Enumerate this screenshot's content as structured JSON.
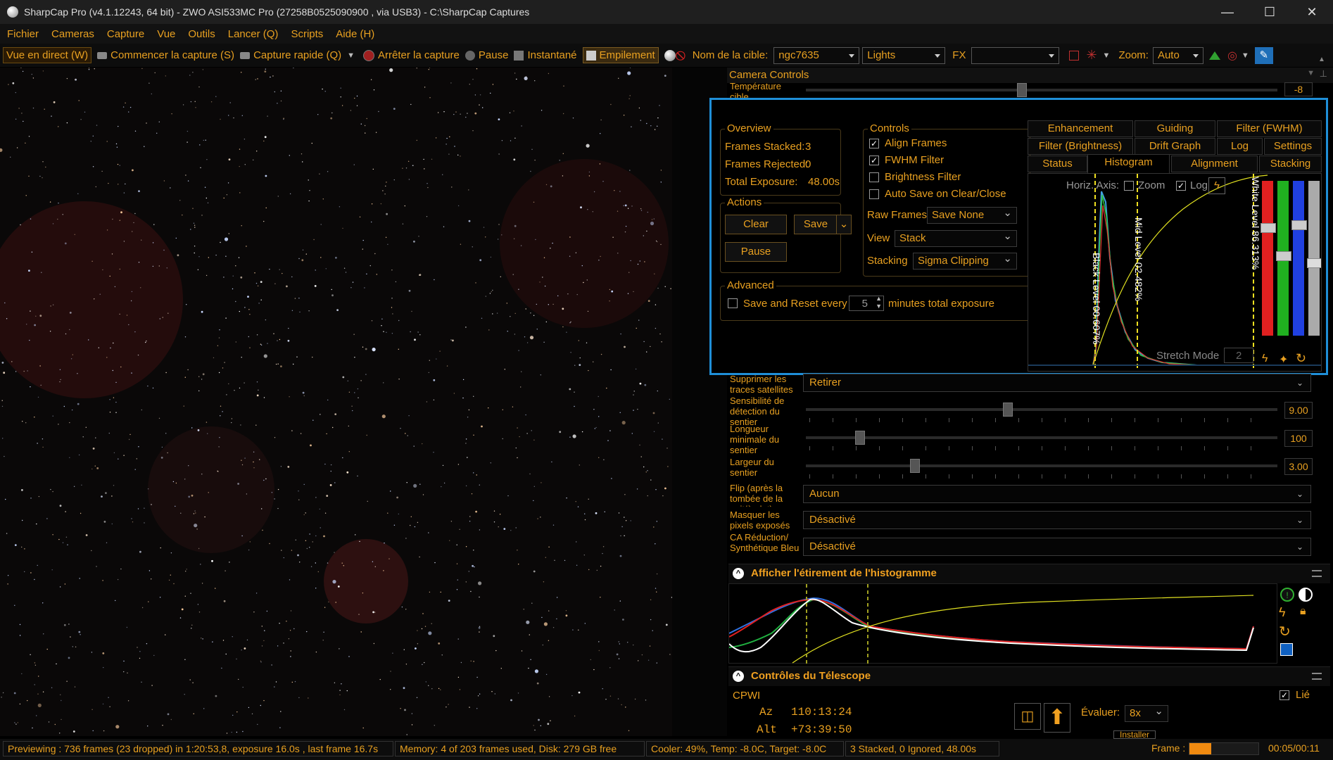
{
  "window": {
    "title": "SharpCap Pro (v4.1.12243, 64 bit) - ZWO ASI533MC Pro (27258B0525090900 , via USB3) - C:\\SharpCap Captures",
    "minimize": "—",
    "maximize": "☐",
    "close": "✕"
  },
  "menu": [
    "Fichier",
    "Cameras",
    "Capture",
    "Vue",
    "Outils",
    "Lancer (Q)",
    "Scripts",
    "Aide (H)"
  ],
  "toolbar": {
    "live_view": "Vue en direct (W)",
    "start_capture": "Commencer la capture (S)",
    "quick_capture": "Capture rapide (Q)",
    "stop_capture": "Arrêter la capture",
    "pause": "Pause",
    "snapshot": "Instantané",
    "stacking": "Empilement",
    "target_label": "Nom de la cible:",
    "target_value": "ngc7635",
    "frame_type": "Lights",
    "fx_label": "FX",
    "fx_value": "",
    "zoom_label": "Zoom:",
    "zoom_value": "Auto"
  },
  "camera_controls": {
    "title": "Camera Controls",
    "temp_label": "Température cible",
    "temp_value": "-8"
  },
  "stacking": {
    "overview": {
      "title": "Overview",
      "frames_stacked_label": "Frames Stacked:",
      "frames_stacked": "3",
      "frames_rejected_label": "Frames Rejected:",
      "frames_rejected": "0",
      "total_exposure_label": "Total Exposure:",
      "total_exposure": "48.00s"
    },
    "actions": {
      "title": "Actions",
      "clear": "Clear",
      "save": "Save",
      "pause": "Pause"
    },
    "advanced": {
      "title": "Advanced",
      "save_reset_label": "Save and Reset every",
      "save_reset_value": "5",
      "minutes_label": "minutes total exposure"
    },
    "controls": {
      "title": "Controls",
      "align_frames": "Align Frames",
      "fwhm_filter": "FWHM Filter",
      "brightness_filter": "Brightness Filter",
      "auto_save": "Auto Save on Clear/Close",
      "raw_frames_label": "Raw Frames",
      "raw_frames_value": "Save None",
      "view_label": "View",
      "view_value": "Stack",
      "stacking_label": "Stacking",
      "stacking_value": "Sigma Clipping"
    },
    "tabs_row1": [
      "Enhancement",
      "Guiding",
      "Filter (FWHM)"
    ],
    "tabs_row2": [
      "Filter (Brightness)",
      "Drift Graph",
      "Log",
      "Settings"
    ],
    "tabs_row3": [
      "Status",
      "Histogram",
      "Alignment",
      "Stacking"
    ],
    "histogram": {
      "horiz_axis": "Horiz. Axis:",
      "zoom": "Zoom",
      "log": "Log",
      "black_level": "Black Level 00.607%",
      "mid_level": "Mid Level 02.482%",
      "white_level": "White Level 86.313%",
      "stretch_mode": "Stretch Mode",
      "stretch_value": "2"
    }
  },
  "settings_rows": {
    "satellite_label": "Supprimer les traces satellites",
    "satellite_value": "Retirer",
    "sensitivity_label": "Sensibilité de détection du sentier",
    "sensitivity_value": "9.00",
    "min_length_label": "Longueur minimale du sentier",
    "min_length_value": "100",
    "width_label": "Largeur du sentier",
    "width_value": "3.00",
    "flip_label": "Flip (après la tombée de la nuit/à plat)",
    "flip_value": "Aucun",
    "mask_label": "Masquer les pixels exposés",
    "mask_value": "Désactivé",
    "ca_label": "CA Réduction/ Synthétique Bleu",
    "ca_value": "Désactivé"
  },
  "histogram_stretch": {
    "title": "Afficher l'étirement de l'histogramme"
  },
  "telescope": {
    "title": "Contrôles du Télescope",
    "mount": "CPWI",
    "linked_label": "Lié",
    "az_label": "Az",
    "az_value": "110:13:24",
    "alt_label": "Alt",
    "alt_value": "+73:39:50",
    "rate_label": "Évaluer:",
    "rate_value": "8x",
    "install": "Installer"
  },
  "status_bar": {
    "preview": "Previewing : 736 frames (23 dropped) in 1:20:53,8, exposure 16.0s , last frame 16.7s",
    "memory": "Memory: 4 of 203 frames used, Disk: 279 GB free",
    "cooler": "Cooler: 49%, Temp: -8.0C, Target: -8.0C",
    "stack": "3 Stacked, 0 Ignored, 48.00s",
    "frame_label": "Frame :",
    "frame_progress": 0.32,
    "time": "00:05/00:11"
  },
  "colors": {
    "accent": "#e8a020",
    "selection": "#1f8fd8",
    "red_channel": "#e02020",
    "green_channel": "#20b020",
    "blue_channel": "#2040e0"
  }
}
